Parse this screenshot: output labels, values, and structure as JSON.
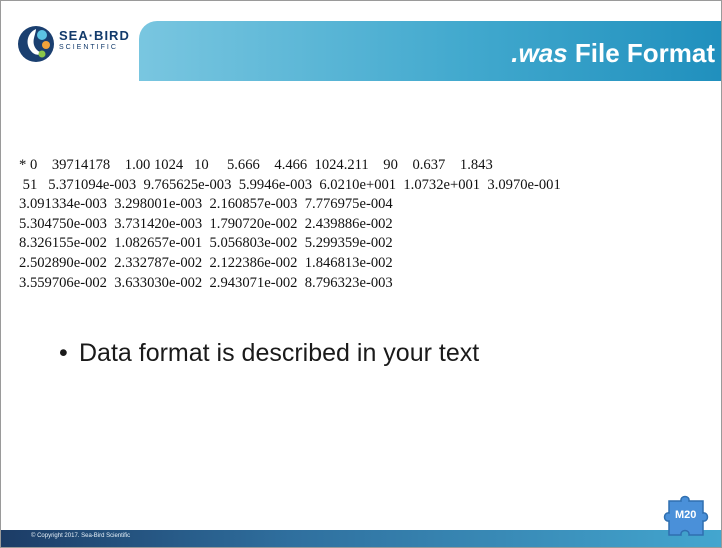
{
  "logo": {
    "brand": "SEA·BIRD",
    "sub": "SCIENTIFIC"
  },
  "title": {
    "emphasis": ".was",
    "rest": " File Format"
  },
  "data_lines": [
    "* 0    39714178    1.00 1024   10     5.666    4.466  1024.211    90    0.637    1.843",
    " 51   5.371094e-003  9.765625e-003  5.9946e-003  6.0210e+001  1.0732e+001  3.0970e-001",
    "3.091334e-003  3.298001e-003  2.160857e-003  7.776975e-004",
    "5.304750e-003  3.731420e-003  1.790720e-002  2.439886e-002",
    "8.326155e-002  1.082657e-001  5.056803e-002  5.299359e-002",
    "2.502890e-002  2.332787e-002  2.122386e-002  1.846813e-002",
    "3.559706e-002  3.633030e-002  2.943071e-002  8.796323e-003"
  ],
  "bullet": "Data format is described in your text",
  "footer": {
    "copyright": "© Copyright 2017. Sea-Bird Scientific"
  },
  "badge": {
    "label": "M20"
  },
  "colors": {
    "title_bar": "#42a9ce",
    "footer": "#1c3c66",
    "badge": "#4a90d9"
  }
}
